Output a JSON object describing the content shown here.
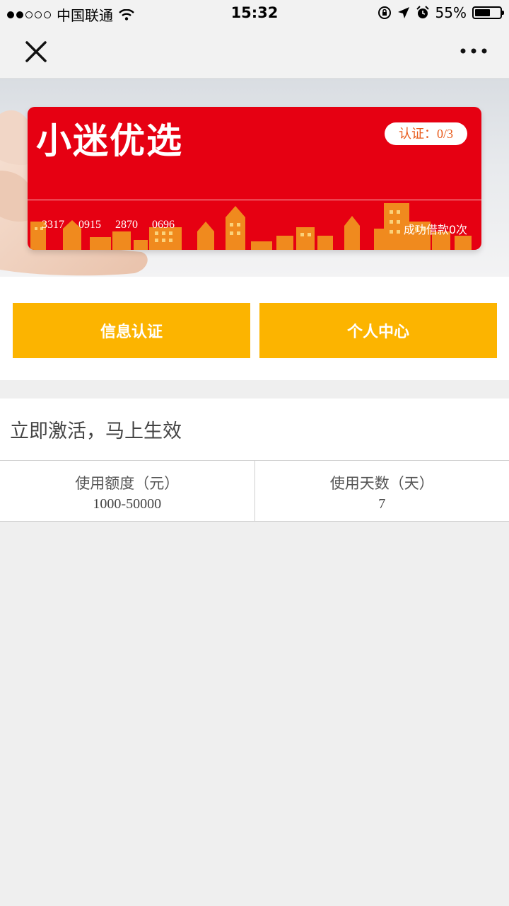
{
  "status_bar": {
    "carrier": "中国联通",
    "time": "15:32",
    "battery": "55%",
    "battery_level": 0.55
  },
  "nav": {
    "close_icon": "close-icon",
    "more_icon": "more-icon"
  },
  "card": {
    "logo": "小迷优选",
    "certification": "认证：0/3",
    "number_groups": [
      "3317",
      "0915",
      "2870",
      "0696"
    ],
    "loans": "成功借款0次",
    "color": "#e60012"
  },
  "actions": {
    "info_cert": "信息认证",
    "personal_center": "个人中心",
    "button_color": "#fcb400"
  },
  "activation": {
    "title": "立即激活，马上生效",
    "columns": [
      {
        "label": "使用额度（元）",
        "value": "1000-50000"
      },
      {
        "label": "使用天数（天）",
        "value": "7"
      }
    ]
  }
}
